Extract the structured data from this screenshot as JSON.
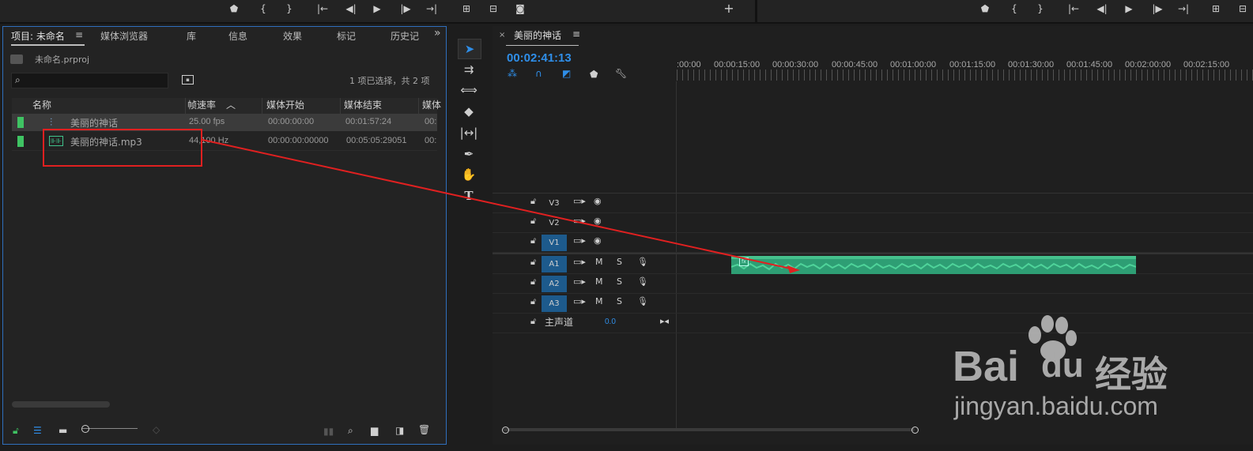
{
  "project_panel": {
    "tabs": [
      "项目: 未命名",
      "媒体浏览器",
      "库",
      "信息",
      "效果",
      "标记",
      "历史记"
    ],
    "tab_menu_icon": "≡",
    "overflow_icon": "»",
    "project_file": "未命名.prproj",
    "selection_status": "1 项已选择，共 2 项",
    "columns": [
      "名称",
      "帧速率",
      "媒体开始",
      "媒体结束",
      "媒体"
    ],
    "rows": [
      {
        "name": "美丽的神话",
        "rate": "25.00 fps",
        "start": "00:00:00:00",
        "end": "00:01:57:24",
        "extra": "00:",
        "icon": "sequence-icon"
      },
      {
        "name": "美丽的神话.mp3",
        "rate": "44,100 Hz",
        "start": "00:00:00:00000",
        "end": "00:05:05:29051",
        "extra": "00:",
        "icon": "audio-file-icon"
      }
    ]
  },
  "timeline": {
    "tab_title": "美丽的神话",
    "timecode": "00:02:41:13",
    "ruler": [
      ":00:00",
      "00:00:15:00",
      "00:00:30:00",
      "00:00:45:00",
      "00:01:00:00",
      "00:01:15:00",
      "00:01:30:00",
      "00:01:45:00",
      "00:02:00:00",
      "00:02:15:00"
    ],
    "video_tracks": [
      "V3",
      "V2",
      "V1"
    ],
    "audio_tracks": [
      "A1",
      "A2",
      "A3"
    ],
    "master_label": "主声道",
    "master_value": "0.0",
    "mute_label": "M",
    "solo_label": "S",
    "clip_badge": "fx"
  },
  "watermark": {
    "brand": "Bai",
    "brand2": "du",
    "cn": "经验",
    "url": "jingyan.baidu.com"
  },
  "colors": {
    "accent_blue": "#2f8ee8",
    "clip_green": "#2e9e74",
    "annotation_red": "#e02020"
  }
}
